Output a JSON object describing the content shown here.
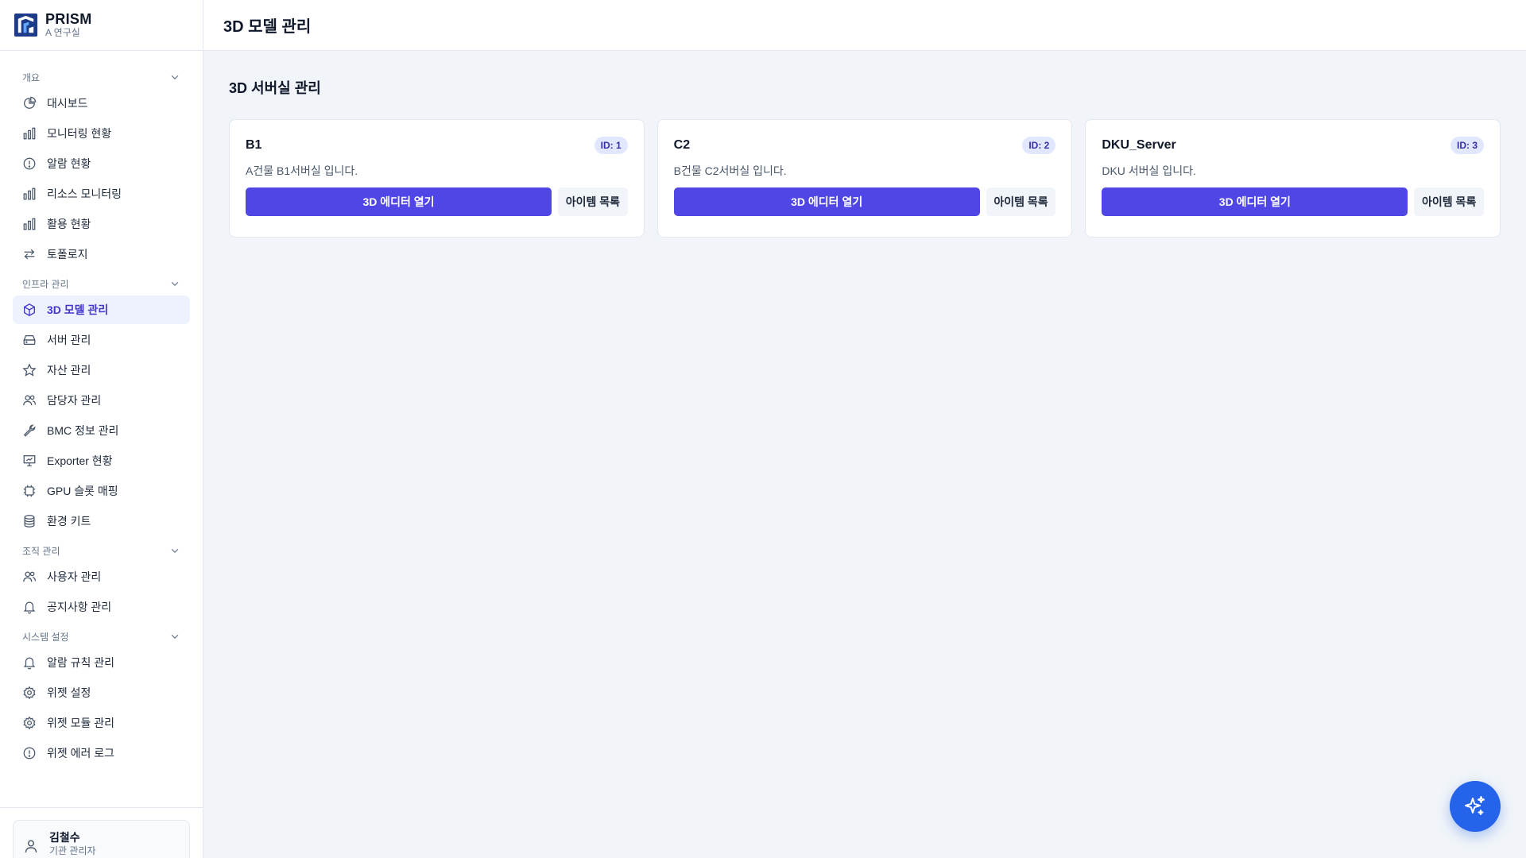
{
  "brand": {
    "name": "PRISM",
    "subtitle": "A 연구실"
  },
  "header": {
    "title": "3D 모델 관리"
  },
  "sidebar": {
    "sections": [
      {
        "label": "개요",
        "items": [
          {
            "label": "대시보드",
            "icon": "pie-chart-icon"
          },
          {
            "label": "모니터링 현황",
            "icon": "bar-chart-icon"
          },
          {
            "label": "알람 현황",
            "icon": "alert-circle-icon"
          },
          {
            "label": "리소스 모니터링",
            "icon": "bar-chart-icon"
          },
          {
            "label": "활용 현황",
            "icon": "bar-chart-icon"
          },
          {
            "label": "토폴로지",
            "icon": "arrows-swap-icon"
          }
        ]
      },
      {
        "label": "인프라 관리",
        "items": [
          {
            "label": "3D 모델 관리",
            "icon": "cube-icon",
            "active": true
          },
          {
            "label": "서버 관리",
            "icon": "server-icon"
          },
          {
            "label": "자산 관리",
            "icon": "star-icon"
          },
          {
            "label": "담당자 관리",
            "icon": "users-icon"
          },
          {
            "label": "BMC 정보 관리",
            "icon": "wrench-icon"
          },
          {
            "label": "Exporter 현황",
            "icon": "presentation-icon"
          },
          {
            "label": "GPU 슬롯 매핑",
            "icon": "chip-icon"
          },
          {
            "label": "환경 키트",
            "icon": "database-icon"
          }
        ]
      },
      {
        "label": "조직 관리",
        "items": [
          {
            "label": "사용자 관리",
            "icon": "users-icon"
          },
          {
            "label": "공지사항 관리",
            "icon": "bell-icon"
          }
        ]
      },
      {
        "label": "시스템 설정",
        "items": [
          {
            "label": "알람 규칙 관리",
            "icon": "bell-icon"
          },
          {
            "label": "위젯 설정",
            "icon": "gear-icon"
          },
          {
            "label": "위젯 모듈 관리",
            "icon": "gear-icon"
          },
          {
            "label": "위젯 에러 로그",
            "icon": "alert-circle-icon"
          }
        ]
      }
    ]
  },
  "user": {
    "name": "김철수",
    "role": "기관 관리자"
  },
  "main": {
    "title": "3D 서버실 관리",
    "cards": [
      {
        "name": "B1",
        "id_label": "ID: 1",
        "description": "A건물 B1서버실 입니다.",
        "primary_label": "3D 에디터 열기",
        "secondary_label": "아이템 목록"
      },
      {
        "name": "C2",
        "id_label": "ID: 2",
        "description": "B건물 C2서버실 입니다.",
        "primary_label": "3D 에디터 열기",
        "secondary_label": "아이템 목록"
      },
      {
        "name": "DKU_Server",
        "id_label": "ID: 3",
        "description": "DKU 서버실 입니다.",
        "primary_label": "3D 에디터 열기",
        "secondary_label": "아이템 목록"
      }
    ]
  },
  "colors": {
    "accent": "#4f46e5",
    "fab": "#2563eb",
    "active_bg": "#eef2ff",
    "brand_navy": "#1e3a8a"
  },
  "fab": {
    "icon": "sparkles-icon"
  }
}
